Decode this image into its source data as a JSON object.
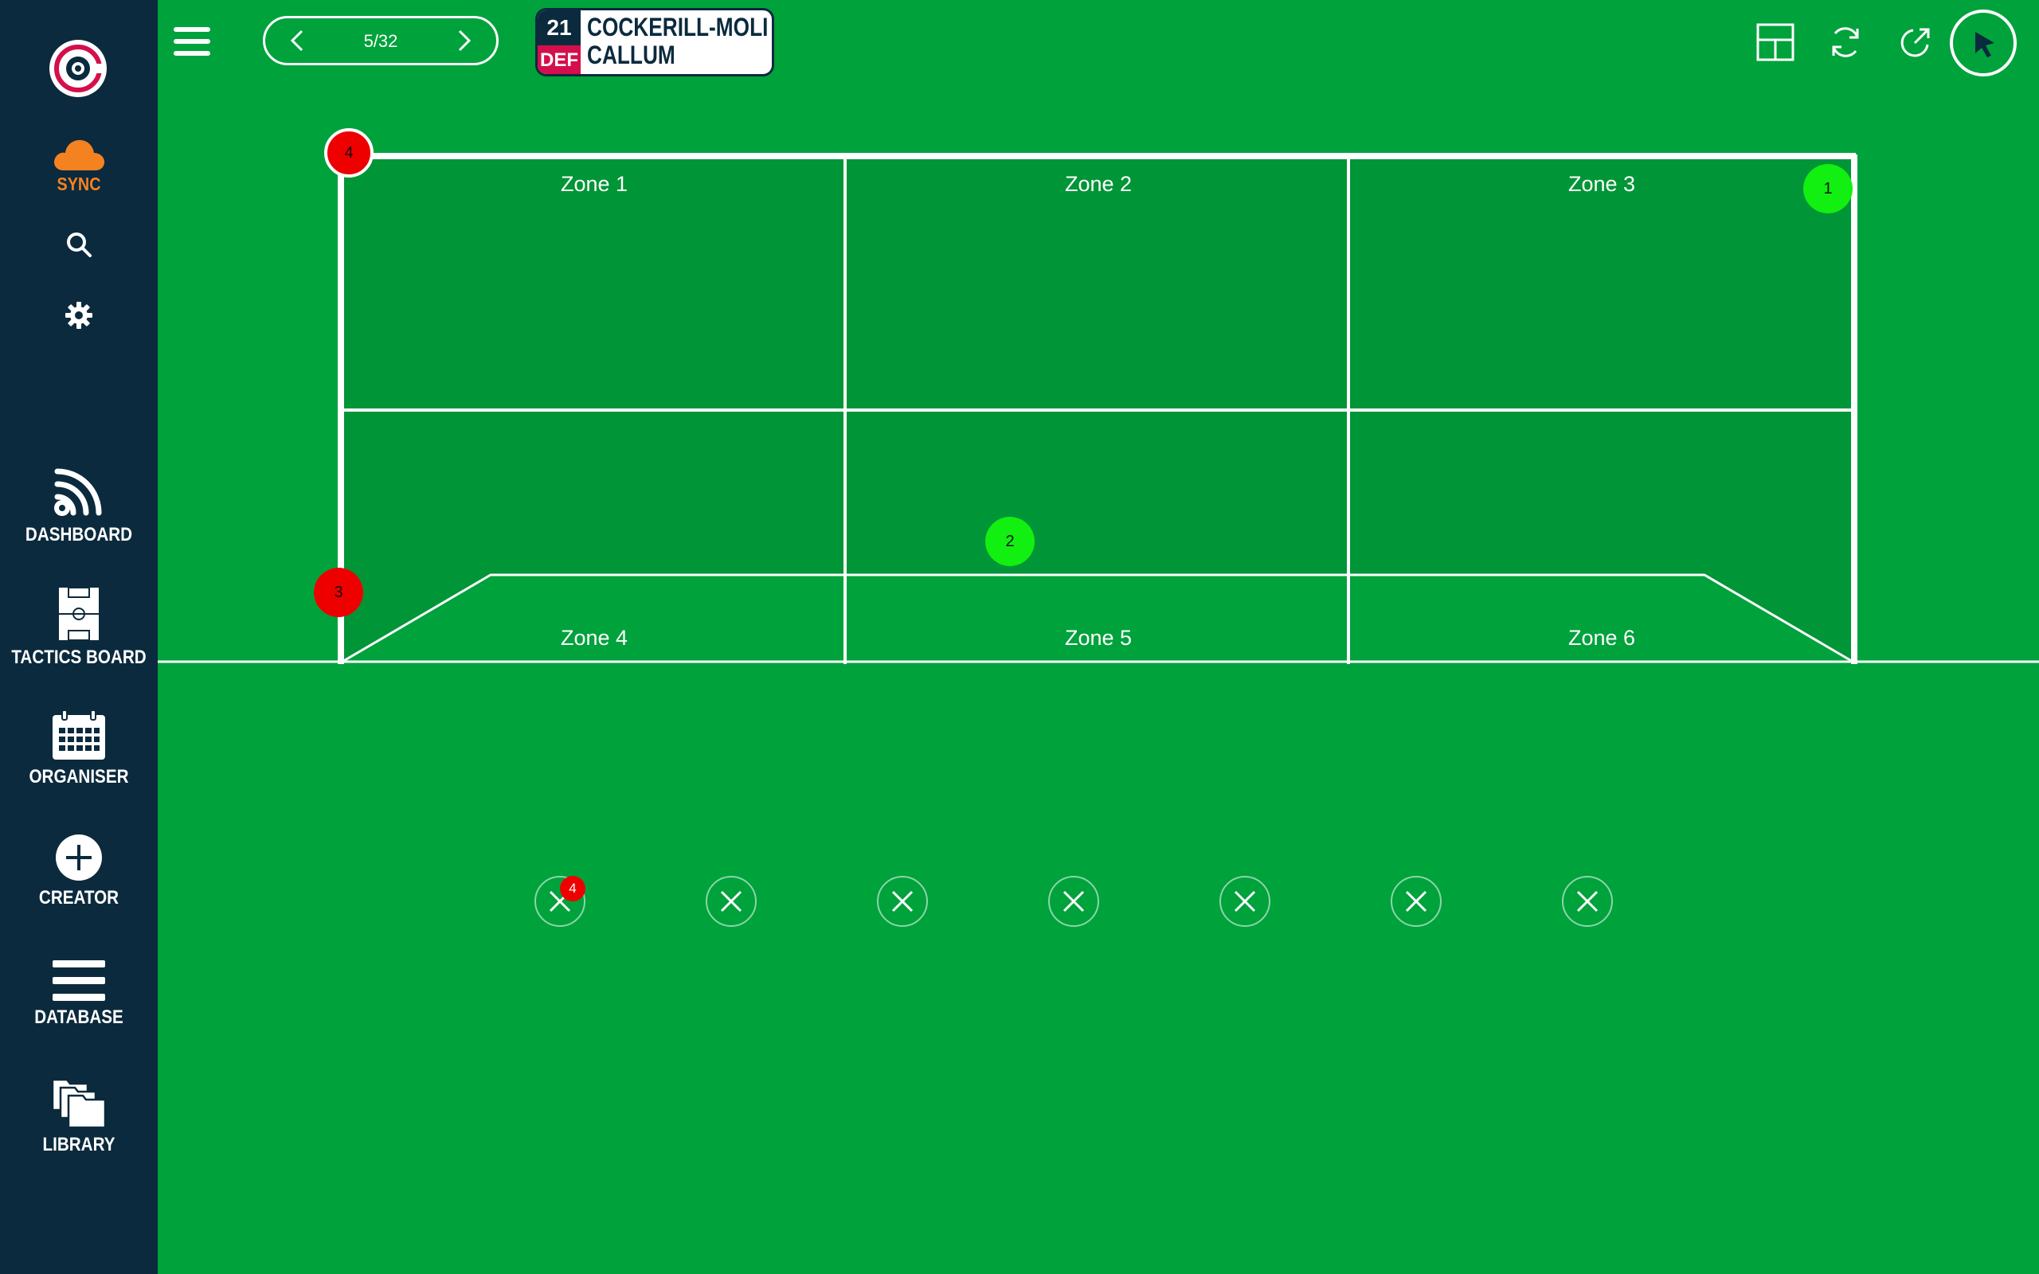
{
  "sidebar": {
    "sync_label": "SYNC",
    "items": [
      {
        "label": "DASHBOARD",
        "icon": "dashboard-icon"
      },
      {
        "label": "TACTICS BOARD",
        "icon": "tactics-board-icon"
      },
      {
        "label": "ORGANISER",
        "icon": "calendar-icon"
      },
      {
        "label": "CREATOR",
        "icon": "plus-circle-icon"
      },
      {
        "label": "DATABASE",
        "icon": "list-icon"
      },
      {
        "label": "LIBRARY",
        "icon": "folders-icon"
      }
    ]
  },
  "topbar": {
    "pager_count": "5/32",
    "player": {
      "number": "21",
      "position": "DEF",
      "surname": "COCKERILL-MOLI",
      "firstname": "CALLUM"
    },
    "tools": [
      "layout-icon",
      "refresh-icon",
      "share-icon",
      "pointer-icon"
    ]
  },
  "goal": {
    "zones": [
      "Zone 1",
      "Zone 2",
      "Zone 3",
      "Zone 4",
      "Zone 5",
      "Zone 6"
    ],
    "markers": [
      {
        "label": "4",
        "color": "red"
      },
      {
        "label": "3",
        "color": "red"
      },
      {
        "label": "1",
        "color": "green"
      },
      {
        "label": "2",
        "color": "green"
      }
    ]
  },
  "slots": {
    "count": 7,
    "first_badge": "4"
  },
  "colors": {
    "sidebar_bg": "#0b2a3d",
    "pitch": "#00a23c",
    "goal_fill": "#009536",
    "sync_orange": "#f58220",
    "def_red": "#d40f4c",
    "marker_red": "#ee0000",
    "marker_green": "#11f011"
  }
}
